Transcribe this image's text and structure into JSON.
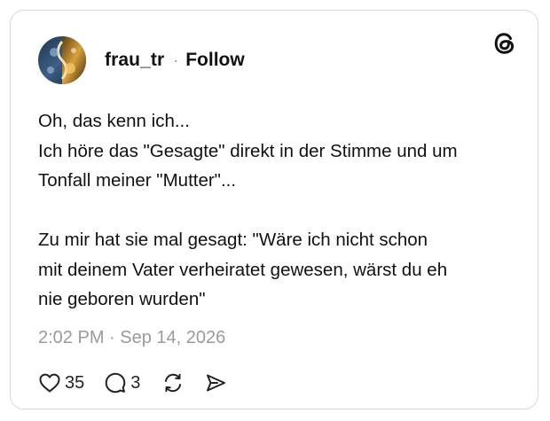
{
  "post": {
    "username": "frau_tr",
    "separator": "·",
    "follow_label": "Follow",
    "lines": [
      "Oh, das kenn ich...",
      "Ich höre das \"Gesagte\" direkt in der Stimme und um",
      "Tonfall meiner \"Mutter\"...",
      "Zu mir hat sie mal gesagt: \"Wäre ich nicht schon",
      "mit deinem Vater verheiratet gewesen, wärst du eh",
      "nie geboren wurden\""
    ],
    "timestamp": "2:02 PM · Sep 14, 2026",
    "likes": "35",
    "replies": "3"
  },
  "icons": {
    "brand": "threads-logo-icon",
    "like": "heart-icon",
    "reply": "comment-bubble-icon",
    "repost": "repost-icon",
    "share": "send-icon"
  },
  "colors": {
    "text": "#111111",
    "muted": "#9a9a9a",
    "border": "#d9d9d9"
  }
}
